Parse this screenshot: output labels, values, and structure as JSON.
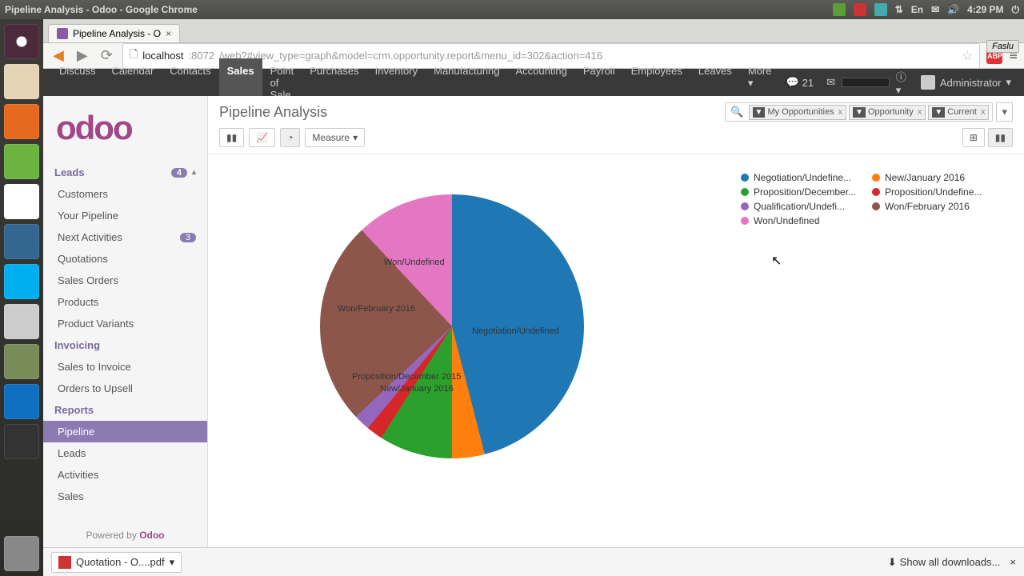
{
  "os": {
    "title": "Pipeline Analysis - Odoo - Google Chrome",
    "time": "4:29 PM",
    "lang": "En"
  },
  "browser": {
    "tab_title": "Pipeline Analysis - O",
    "fastu": "Faslu",
    "url_host": "localhost",
    "url_port": ":8072",
    "url_path": "/web?#view_type=graph&model=crm.opportunity.report&menu_id=302&action=416",
    "abp": "ABP"
  },
  "navbar": {
    "items": [
      "Discuss",
      "Calendar",
      "Contacts",
      "Sales",
      "Point of Sale",
      "Purchases",
      "Inventory",
      "Manufacturing",
      "Accounting",
      "Payroll",
      "Employees",
      "Leaves",
      "More"
    ],
    "active": "Sales",
    "msg_count": "21",
    "user": "Administrator"
  },
  "sidebar": {
    "logo": "odoo",
    "section_sales": "Leads",
    "leads_badge": "4",
    "items_sales": [
      {
        "label": "Customers"
      },
      {
        "label": "Your Pipeline"
      },
      {
        "label": "Next Activities",
        "badge": "3"
      },
      {
        "label": "Quotations"
      },
      {
        "label": "Sales Orders"
      },
      {
        "label": "Products"
      },
      {
        "label": "Product Variants"
      }
    ],
    "section_invoicing": "Invoicing",
    "items_invoicing": [
      {
        "label": "Sales to Invoice"
      },
      {
        "label": "Orders to Upsell"
      }
    ],
    "section_reports": "Reports",
    "items_reports": [
      {
        "label": "Pipeline",
        "active": true
      },
      {
        "label": "Leads"
      },
      {
        "label": "Activities"
      },
      {
        "label": "Sales"
      }
    ],
    "powered_prefix": "Powered by ",
    "powered_brand": "Odoo"
  },
  "page": {
    "title": "Pipeline Analysis",
    "filters": [
      {
        "label": "My Opportunities"
      },
      {
        "label": "Opportunity"
      },
      {
        "label": "Current"
      }
    ],
    "measure_btn": "Measure"
  },
  "chart_data": {
    "type": "pie",
    "title": "Pipeline Analysis",
    "series": [
      {
        "name": "Negotiation/Undefined",
        "value": 46,
        "color": "#1f77b4"
      },
      {
        "name": "New/January 2016",
        "value": 4,
        "color": "#ff7f0e"
      },
      {
        "name": "Proposition/December 2015",
        "value": 9,
        "color": "#2ca02c"
      },
      {
        "name": "Proposition/Undefined",
        "value": 2,
        "color": "#d62728"
      },
      {
        "name": "Qualification/Undefined",
        "value": 2,
        "color": "#9467bd"
      },
      {
        "name": "Won/February 2016",
        "value": 25,
        "color": "#8c564b"
      },
      {
        "name": "Won/Undefined",
        "value": 12,
        "color": "#e377c2"
      }
    ],
    "legend_labels": [
      "Negotiation/Undefine...",
      "New/January 2016",
      "Proposition/December...",
      "Proposition/Undefine...",
      "Qualification/Undefi...",
      "Won/February 2016",
      "Won/Undefined"
    ]
  },
  "downloads": {
    "item": "Quotation - O....pdf",
    "show_all": "Show all downloads..."
  }
}
